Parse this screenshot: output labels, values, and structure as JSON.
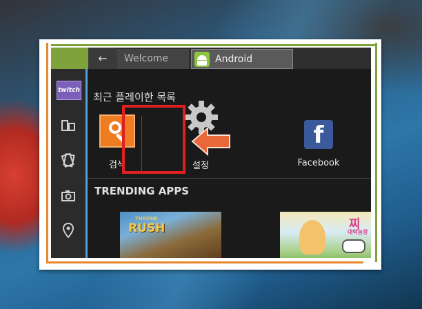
{
  "tabs": {
    "back_glyph": "←",
    "welcome": "Welcome",
    "android": "Android"
  },
  "sidebar": {
    "twitch_label": "twitch",
    "items": [
      "twitch-icon",
      "apps-icon",
      "cards-icon",
      "camera-icon",
      "location-icon"
    ]
  },
  "recent": {
    "title": "최근 플레이한 목록",
    "apps": [
      {
        "label": "검색",
        "icon": "search-icon"
      },
      {
        "label": "설정",
        "icon": "gear-icon"
      },
      {
        "label": "Facebook",
        "icon": "facebook-icon"
      }
    ]
  },
  "trending": {
    "title": "TRENDING APPS",
    "thumb1_logo": "RUSH",
    "thumb1_small": "THRONE",
    "thumb2_title": "찌",
    "thumb2_sub": "대박농장"
  },
  "colors": {
    "highlight": "#e02020",
    "arrow": "#e8683a",
    "search_tile": "#ee7d22",
    "facebook": "#3a5a9c",
    "accent_green": "#7fa23a",
    "accent_orange": "#e8862a"
  }
}
